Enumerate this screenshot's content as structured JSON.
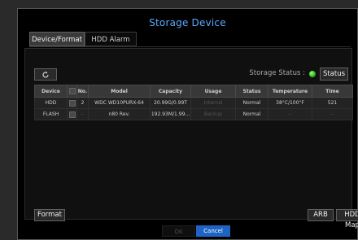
{
  "window": {
    "title": "Storage Device"
  },
  "tabs": [
    {
      "label": "Device/Format",
      "active": true
    },
    {
      "label": "HDD Alarm",
      "active": false
    }
  ],
  "toolbar": {
    "storage_status_label": "Storage Status :",
    "status_indicator_color": "#2db61c",
    "status_button": "Status"
  },
  "table": {
    "headers": [
      "Device",
      "",
      "No.",
      "Model",
      "Capacity",
      "Usage",
      "Status",
      "Temperature",
      "Time"
    ],
    "rows": [
      {
        "device": "HDD",
        "no": "2",
        "model": "WDC WD10PURX-64",
        "capacity": "20.99G/0.99T",
        "usage": "Internal",
        "status": "Normal",
        "temperature": "38°C/100°F",
        "time": "521"
      },
      {
        "device": "FLASH",
        "no": "--",
        "model": "n80 Rev.",
        "capacity": "192.93M/1.99...",
        "usage": "Backup",
        "status": "Normal",
        "temperature": "--",
        "time": "--"
      }
    ]
  },
  "buttons": {
    "format": "Format",
    "arb": "ARB",
    "hdd_map": "HDD Map",
    "ok": "OK",
    "cancel": "Cancel"
  },
  "colors": {
    "accent": "#1d64c5",
    "title": "#5aa9ff"
  },
  "icons": {
    "refresh": "refresh-icon"
  }
}
